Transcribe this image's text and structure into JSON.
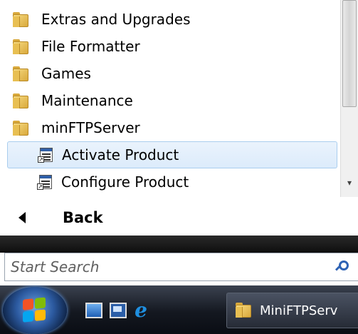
{
  "programs": {
    "folders": [
      {
        "label": "Extras and Upgrades"
      },
      {
        "label": "File Formatter"
      },
      {
        "label": "Games"
      },
      {
        "label": "Maintenance"
      },
      {
        "label": "minFTPServer"
      }
    ],
    "subitems": [
      {
        "label": "Activate Product",
        "highlighted": true
      },
      {
        "label": "Configure Product",
        "highlighted": false
      }
    ],
    "icons": {
      "folder": "folder-icon",
      "program": "program-shortcut-icon"
    }
  },
  "back": {
    "label": "Back"
  },
  "search": {
    "placeholder": "Start Search"
  },
  "taskbar": {
    "quick_launch": [
      "show-desktop-icon",
      "switch-windows-icon",
      "internet-explorer-icon"
    ],
    "ie_glyph": "e",
    "active_task": {
      "label": "MiniFTPServ"
    }
  },
  "colors": {
    "highlight_border": "#a9cdee",
    "highlight_fill": "#dcebfb",
    "search_icon": "#2e63b5"
  }
}
